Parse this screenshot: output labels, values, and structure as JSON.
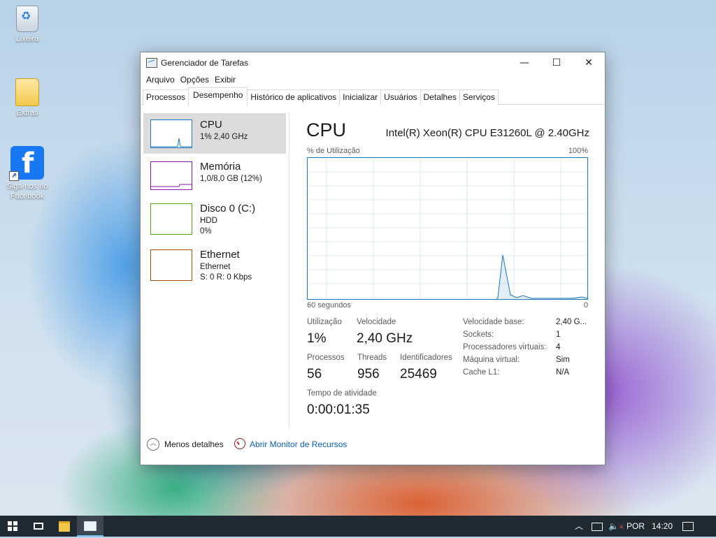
{
  "desktop": {
    "icons": [
      {
        "label": "Lixeira"
      },
      {
        "label": "Extras"
      },
      {
        "label": "Siga-nos no Facebook"
      }
    ]
  },
  "window": {
    "title": "Gerenciador de Tarefas",
    "controls": {
      "minimize": "—",
      "maximize": "☐",
      "close": "✕"
    },
    "menu": [
      "Arquivo",
      "Opções",
      "Exibir"
    ],
    "tabs": [
      "Processos",
      "Desempenho",
      "Histórico de aplicativos",
      "Inicializar",
      "Usuários",
      "Detalhes",
      "Serviços"
    ],
    "active_tab": "Desempenho"
  },
  "resources": [
    {
      "name": "CPU",
      "line1": "1% 2,40 GHz",
      "line2": "",
      "color": "#1e77b9"
    },
    {
      "name": "Memória",
      "line1": "1,0/8,0 GB (12%)",
      "line2": "",
      "color": "#8b12ae"
    },
    {
      "name": "Disco 0 (C:)",
      "line1": "HDD",
      "line2": "0%",
      "color": "#4da60c"
    },
    {
      "name": "Ethernet",
      "line1": "Ethernet",
      "line2": "S: 0 R: 0 Kbps",
      "color": "#a74f01"
    }
  ],
  "detail": {
    "title": "CPU",
    "model": "Intel(R) Xeon(R) CPU E31260L @ 2.40GHz",
    "graph": {
      "y_label": "% de Utilização",
      "y_max_label": "100%",
      "x_left_label": "60 segundos",
      "x_right_label": "0",
      "line_color": "#1e77b9"
    },
    "stats": {
      "utilizacao_label": "Utilização",
      "utilizacao": "1%",
      "velocidade_label": "Velocidade",
      "velocidade": "2,40 GHz",
      "processos_label": "Processos",
      "processos": "56",
      "threads_label": "Threads",
      "threads": "956",
      "identificadores_label": "Identificadores",
      "identificadores": "25469",
      "tempo_label": "Tempo de atividade",
      "tempo": "0:00:01:35"
    },
    "info": [
      {
        "label": "Velocidade base:",
        "value": "2,40 G..."
      },
      {
        "label": "Sockets:",
        "value": "1"
      },
      {
        "label": "Processadores virtuais:",
        "value": "4"
      },
      {
        "label": "Máquina virtual:",
        "value": "Sim"
      },
      {
        "label": "Cache L1:",
        "value": "N/A"
      }
    ]
  },
  "footer": {
    "less_details": "Menos detalhes",
    "resource_monitor": "Abrir Monitor de Recursos"
  },
  "taskbar": {
    "language": "POR",
    "time": "14:20"
  }
}
